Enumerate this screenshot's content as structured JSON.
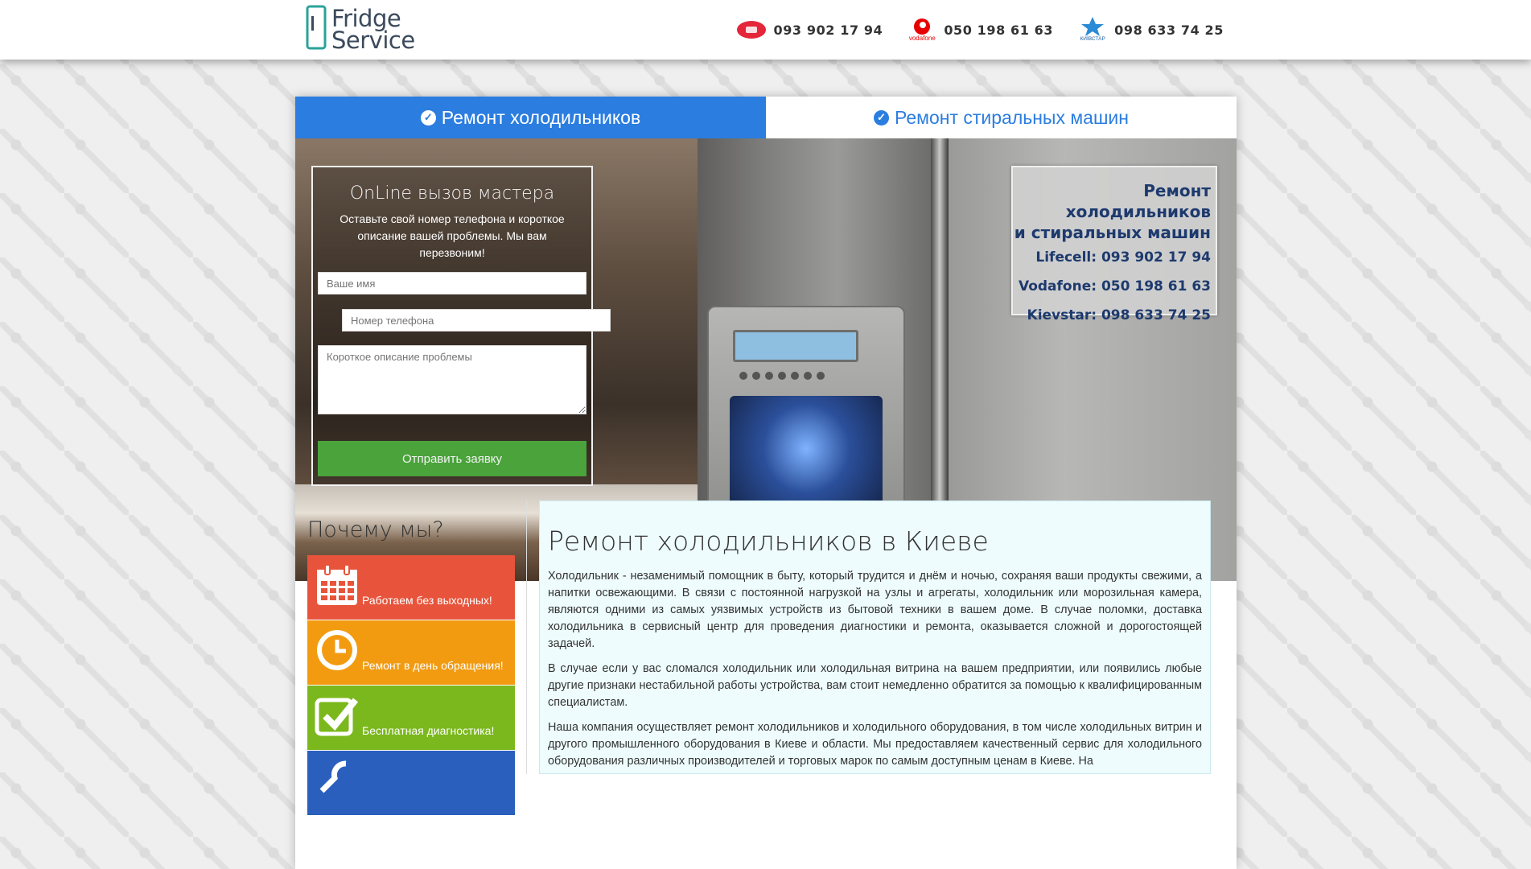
{
  "header": {
    "logo_text": [
      "Fridge",
      "Service"
    ],
    "phones": [
      {
        "operator": "lifecell",
        "icon": "lifecell-logo-icon",
        "number": "093 902 17 94"
      },
      {
        "operator": "vodafone",
        "icon": "vodafone-logo-icon",
        "number": "050 198 61 63",
        "logo_label": "vodafone"
      },
      {
        "operator": "kyivstar",
        "icon": "kyivstar-star-icon",
        "number": "098 633 74 25",
        "logo_label": "КИЇВСТАР"
      }
    ]
  },
  "tabs": [
    {
      "label": "Ремонт холодильников",
      "active": true
    },
    {
      "label": "Ремонт стиральных машин",
      "active": false
    }
  ],
  "form": {
    "title": "OnLine вызов мастера",
    "description": "Оставьте свой номер телефона и короткое описание вашей проблемы. Мы вам перезвоним!",
    "name_placeholder": "Ваше имя",
    "phone_placeholder": "Номер телефона",
    "desc_placeholder": "Короткое описание проблемы",
    "submit_label": "Отправить заявку"
  },
  "contact_box": {
    "title_line1": "Ремонт холодильников",
    "title_line2": "и стиральных машин",
    "lines": [
      "Lifecell: 093 902 17 94",
      "Vodafone: 050 198 61 63",
      "Kievstar: 098 633 74 25"
    ]
  },
  "why": {
    "title": "Почему мы?",
    "features": [
      {
        "label": "Работаем без выходных!",
        "icon": "calendar-icon",
        "color": "#e8543b"
      },
      {
        "label": "Ремонт в день обращения!",
        "icon": "clock-icon",
        "color": "#f29b11"
      },
      {
        "label": "Бесплатная диагностика!",
        "icon": "checkmark-icon",
        "color": "#7bb81d"
      },
      {
        "label": "",
        "icon": "wrench-icon",
        "color": "#2a5fbd"
      }
    ]
  },
  "article": {
    "title": "Ремонт холодильников в Киеве",
    "paragraphs": [
      "Холодильник - незаменимый помощник в быту, который трудится и днём и ночью, сохраняя ваши продукты свежими, а напитки освежающими. В связи с постоянной нагрузкой на узлы и агрегаты, холодильник или морозильная камера, являются одними из самых уязвимых устройств из бытовой техники в вашем доме. В случае поломки, доставка холодильника в сервисный центр для проведения диагностики и ремонта, оказывается сложной и дорогостоящей задачей.",
      "В случае если у вас сломался холодильник или холодильная витрина на вашем предприятии, или появились любые другие признаки нестабильной работы устройства, вам стоит немедленно обратится за помощью к квалифицированным специалистам.",
      "Наша компания осуществляет ремонт холодильников и холодильного оборудования, в том числе холодильных витрин и другого промышленного оборудования в Киеве и области. Мы предоставляем качественный сервис для холодильного оборудования различных производителей и торговых марок по самым доступным ценам в Киеве. На"
    ]
  },
  "colors": {
    "accent_blue": "#2b7de0",
    "submit_green": "#4aa33b",
    "contact_navy": "#1d3a6e"
  }
}
